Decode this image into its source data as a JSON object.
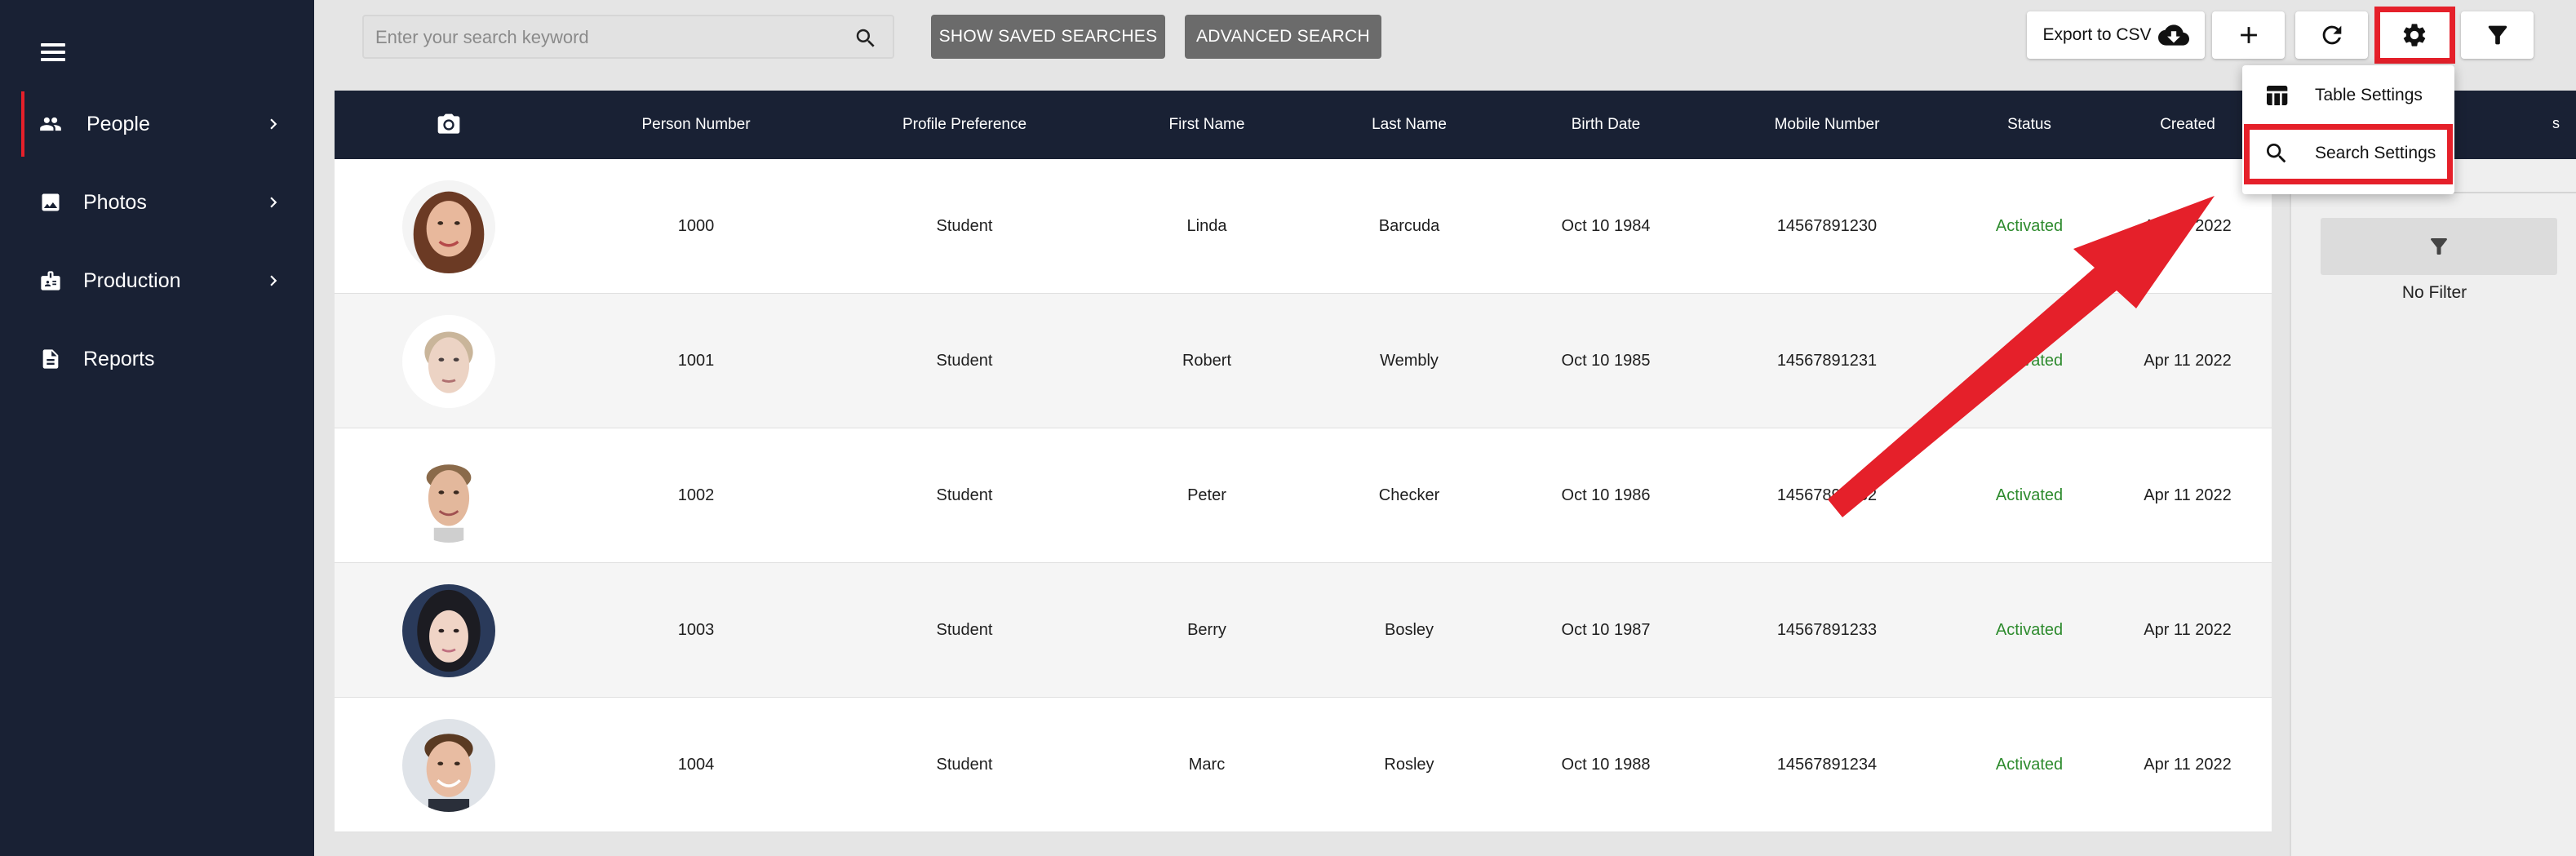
{
  "sidebar": {
    "items": [
      {
        "label": "People",
        "icon": "people-icon",
        "active": true,
        "has_children": true
      },
      {
        "label": "Photos",
        "icon": "photo-icon",
        "active": false,
        "has_children": true
      },
      {
        "label": "Production",
        "icon": "badge-icon",
        "active": false,
        "has_children": true
      },
      {
        "label": "Reports",
        "icon": "document-icon",
        "active": false,
        "has_children": false
      }
    ]
  },
  "toolbar": {
    "search_placeholder": "Enter your search keyword",
    "search_value": "",
    "show_saved_label": "SHOW SAVED SEARCHES",
    "advanced_label": "ADVANCED SEARCH",
    "export_label": "Export to CSV"
  },
  "menu": {
    "table_settings": "Table Settings",
    "search_settings": "Search Settings"
  },
  "table": {
    "headers": [
      "Person Number",
      "Profile Preference",
      "First Name",
      "Last Name",
      "Birth Date",
      "Mobile Number",
      "Status",
      "Created"
    ],
    "rows": [
      {
        "number": "1000",
        "profile": "Student",
        "first": "Linda",
        "last": "Barcuda",
        "birth": "Oct 10 1984",
        "mobile": "14567891230",
        "status": "Activated",
        "created": "Apr 11 2022"
      },
      {
        "number": "1001",
        "profile": "Student",
        "first": "Robert",
        "last": "Wembly",
        "birth": "Oct 10 1985",
        "mobile": "14567891231",
        "status": "Activated",
        "created": "Apr 11 2022"
      },
      {
        "number": "1002",
        "profile": "Student",
        "first": "Peter",
        "last": "Checker",
        "birth": "Oct 10 1986",
        "mobile": "14567891232",
        "status": "Activated",
        "created": "Apr 11 2022"
      },
      {
        "number": "1003",
        "profile": "Student",
        "first": "Berry",
        "last": "Bosley",
        "birth": "Oct 10 1987",
        "mobile": "14567891233",
        "status": "Activated",
        "created": "Apr 11 2022"
      },
      {
        "number": "1004",
        "profile": "Student",
        "first": "Marc",
        "last": "Rosley",
        "birth": "Oct 10 1988",
        "mobile": "14567891234",
        "status": "Activated",
        "created": "Apr 11 2022"
      }
    ]
  },
  "filter_panel": {
    "header_fragment": "s",
    "no_filter": "No Filter"
  },
  "colors": {
    "sidebar_bg": "#192134",
    "accent_red": "#e5202a",
    "status_green": "#2e8b2e",
    "button_grey": "#6b6b6b"
  }
}
